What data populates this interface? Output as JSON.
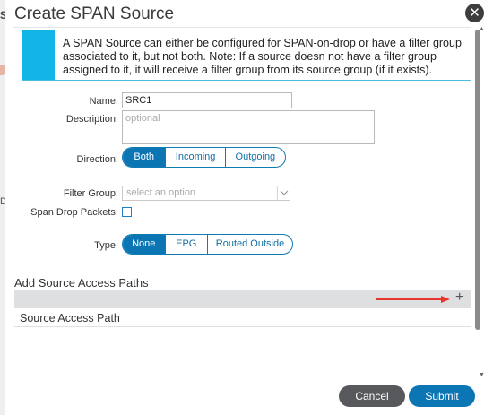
{
  "background": {
    "fragment_top": "Sc",
    "fragment_mid": "De"
  },
  "dialog": {
    "title": "Create SPAN Source",
    "info": "A SPAN Source can either be configured for SPAN-on-drop or have a filter group associated to it, but not both. Note: If a source doesn not have a filter group assigned to it, it will receive a filter group from its source group (if it exists)."
  },
  "form": {
    "name_label": "Name:",
    "name_value": "SRC1",
    "description_label": "Description:",
    "description_placeholder": "optional",
    "direction_label": "Direction:",
    "direction_options": [
      "Both",
      "Incoming",
      "Outgoing"
    ],
    "direction_selected": "Both",
    "filter_group_label": "Filter Group:",
    "filter_group_placeholder": "select an option",
    "span_drop_label": "Span Drop Packets:",
    "span_drop_checked": false,
    "type_label": "Type:",
    "type_options": [
      "None",
      "EPG",
      "Routed Outside"
    ],
    "type_selected": "None"
  },
  "access_paths": {
    "section_title": "Add Source Access Paths",
    "add_icon": "plus-icon",
    "column_header": "Source Access Path"
  },
  "footer": {
    "cancel_label": "Cancel",
    "submit_label": "Submit"
  },
  "colors": {
    "primary": "#0c76b4",
    "info_accent": "#12b5e6",
    "arrow": "#e8362c",
    "cancel": "#57595c"
  }
}
